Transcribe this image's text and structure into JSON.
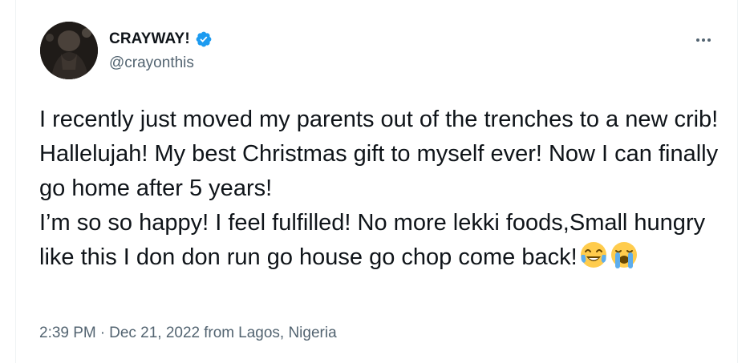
{
  "author": {
    "display_name": "CRAYWAY!",
    "handle": "@crayonthis",
    "verified_icon": "verified-badge-icon",
    "avatar_icon": "avatar"
  },
  "tweet": {
    "text": "I recently just moved my parents out of the trenches to a new crib! Hallelujah! My best Christmas gift to myself ever! Now I can finally go home after 5 years!\nI’m so so happy! I feel fulfilled! No more lekki foods,Small hungry like this I don don run go house go chop come back!",
    "emojis": [
      "face-with-tears-of-joy-icon",
      "loudly-crying-face-icon"
    ]
  },
  "meta": {
    "time": "2:39 PM",
    "separator": "·",
    "date": "Dec 21, 2022",
    "from_label": "from",
    "location": "Lagos, Nigeria"
  },
  "colors": {
    "text_primary": "#0f1419",
    "text_secondary": "#536471",
    "verified_blue": "#1d9bf0",
    "border": "#eff3f4"
  }
}
